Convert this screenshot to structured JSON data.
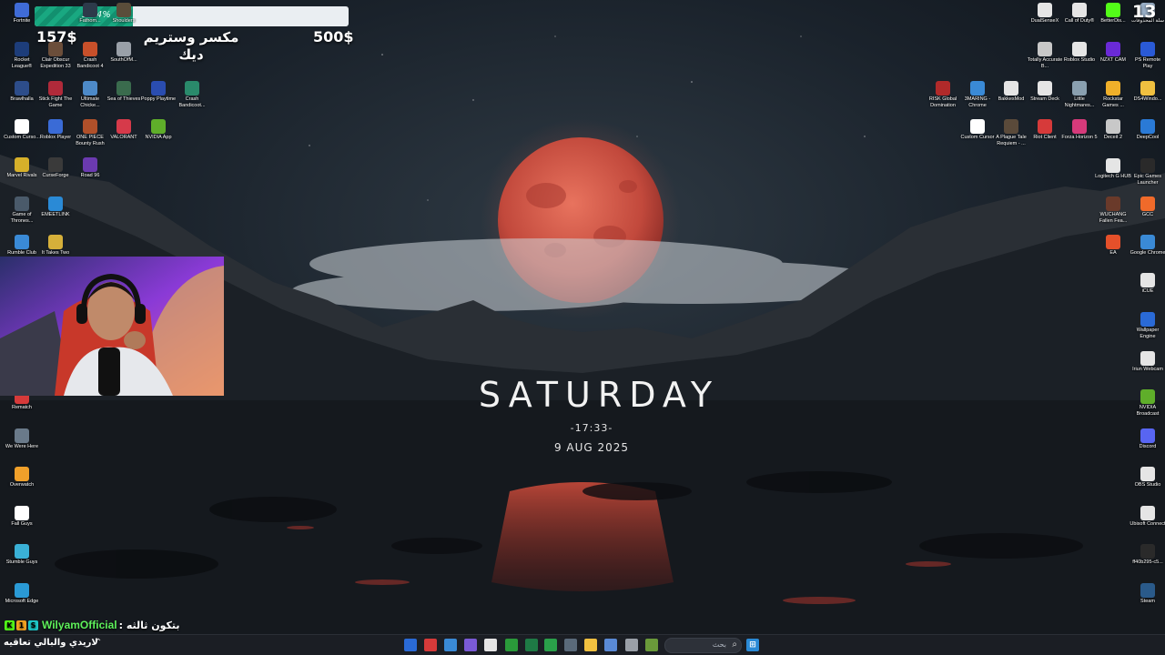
{
  "overlay": {
    "progress_label": "31.4%",
    "progress_fraction": 0.314,
    "current_amount": "157$",
    "target_amount": "500$",
    "goal_line1": "مكسر وستريم",
    "goal_line2": "ديك"
  },
  "clock": {
    "day": "SATURDAY",
    "time": "-17:33-",
    "date": "9 AUG 2025"
  },
  "chat": {
    "username": "WilyamOfficial",
    "message": "بتكون ثالثه :"
  },
  "taskbar": {
    "ticker_text": "لاريدي والبالي تعاقيه",
    "search_placeholder": "بحث"
  },
  "top_right_counter": "13",
  "desktop_left": [
    {
      "label": "Fortnite",
      "icon": "fortnite-icon",
      "color": "#3f6bd6"
    },
    {
      "label": "Fathom...",
      "icon": "game-icon",
      "color": "#2d3a4a"
    },
    {
      "label": "Shoulders",
      "icon": "game-icon",
      "color": "#5a4d3a"
    },
    {
      "label": "Rocket League®",
      "icon": "rocket-league-icon",
      "color": "#1d3d7a"
    },
    {
      "label": "Clair Obscur Expedition 33",
      "icon": "game-icon",
      "color": "#6b4e3a"
    },
    {
      "label": "Crash Bandicoot 4",
      "icon": "game-icon",
      "color": "#c8502a"
    },
    {
      "label": "SouthOfM...",
      "icon": "game-icon",
      "color": "#9aa0a8"
    },
    {
      "label": "Brawlhalla",
      "icon": "game-icon",
      "color": "#2d4d8a"
    },
    {
      "label": "Stick Fight The Game",
      "icon": "game-icon",
      "color": "#b02a3a"
    },
    {
      "label": "Ultimate Chicke...",
      "icon": "game-icon",
      "color": "#4d8ac8"
    },
    {
      "label": "Sea of Thieves",
      "icon": "game-icon",
      "color": "#3a6b4d"
    },
    {
      "label": "Poppy Playtime",
      "icon": "game-icon",
      "color": "#2a4db0"
    },
    {
      "label": "Crash Bandicoot...",
      "icon": "game-icon",
      "color": "#2a8a6b"
    },
    {
      "label": "Custom Curso...",
      "icon": "cursor-icon",
      "color": "#ffffff"
    },
    {
      "label": "Roblox Player",
      "icon": "roblox-icon",
      "color": "#3a6bd6"
    },
    {
      "label": "ONE PIECE Bounty Rush",
      "icon": "game-icon",
      "color": "#b0502a"
    },
    {
      "label": "VALORANT",
      "icon": "valorant-icon",
      "color": "#d63a4a"
    },
    {
      "label": "NVIDIA App",
      "icon": "nvidia-icon",
      "color": "#5fae2a"
    },
    {
      "label": "Marvel Rivals",
      "icon": "game-icon",
      "color": "#d6b02a"
    },
    {
      "label": "CurseForge",
      "icon": "curseforge-icon",
      "color": "#3a3a3a"
    },
    {
      "label": "Road 96",
      "icon": "game-icon",
      "color": "#6b3ab0"
    },
    {
      "label": "Game of Thrones...",
      "icon": "game-icon",
      "color": "#4a5a6a"
    },
    {
      "label": "EMEETLINK",
      "icon": "emeet-icon",
      "color": "#2a8ad6"
    },
    {
      "label": "Rumble Club",
      "icon": "game-icon",
      "color": "#3a8ad6"
    },
    {
      "label": "It Takes Two",
      "icon": "game-icon",
      "color": "#d6b03a"
    },
    {
      "label": "Rematch",
      "icon": "game-icon",
      "color": "#d63a3a"
    },
    {
      "label": "We Were Here",
      "icon": "game-icon",
      "color": "#6a7a8a"
    },
    {
      "label": "Overwatch",
      "icon": "overwatch-icon",
      "color": "#f0a02a"
    },
    {
      "label": "Fall Guys",
      "icon": "fall-guys-icon",
      "color": "#ffffff"
    },
    {
      "label": "Stumble Guys",
      "icon": "game-icon",
      "color": "#3ab0d6"
    },
    {
      "label": "Microsoft Edge",
      "icon": "edge-icon",
      "color": "#2a9ad6"
    }
  ],
  "desktop_right": [
    {
      "label": "DualSenseX",
      "icon": "controller-icon",
      "color": "#e5e5e5"
    },
    {
      "label": "Call of Duty®",
      "icon": "cod-icon",
      "color": "#e5e5e5"
    },
    {
      "label": "BetterDis...",
      "icon": "kick-icon",
      "color": "#53fc18"
    },
    {
      "label": "سلة المحذوفات",
      "icon": "recycle-bin-icon",
      "color": "#9ab0c8"
    },
    {
      "label": "Totally Accurate B...",
      "icon": "game-icon",
      "color": "#c8c8c8"
    },
    {
      "label": "Roblox Studio",
      "icon": "roblox-studio-icon",
      "color": "#e5e5e5"
    },
    {
      "label": "NZXT CAM",
      "icon": "nzxt-icon",
      "color": "#6a2ad6"
    },
    {
      "label": "PS Remote Play",
      "icon": "ps-icon",
      "color": "#2a5ad6"
    },
    {
      "label": "RISK Global Domination",
      "icon": "game-icon",
      "color": "#b02a2a"
    },
    {
      "label": "3MARING - Chrome",
      "icon": "chrome-icon",
      "color": "#3a8ad6"
    },
    {
      "label": "BakkesMod",
      "icon": "bakkes-icon",
      "color": "#e5e5e5"
    },
    {
      "label": "Stream Deck",
      "icon": "stream-deck-icon",
      "color": "#e5e5e5"
    },
    {
      "label": "Little Nightmares...",
      "icon": "game-icon",
      "color": "#8aa0b0"
    },
    {
      "label": "Rockstar Games ...",
      "icon": "rockstar-icon",
      "color": "#f0b02a"
    },
    {
      "label": "DS4Windo...",
      "icon": "folder-icon",
      "color": "#f0c040"
    },
    {
      "label": "Custom Cursor",
      "icon": "cursor-icon",
      "color": "#ffffff"
    },
    {
      "label": "A Plague Tale Requiem - ...",
      "icon": "game-icon",
      "color": "#5a4a3a"
    },
    {
      "label": "Riot Client",
      "icon": "riot-icon",
      "color": "#d63a3a"
    },
    {
      "label": "Forza Horizon 5",
      "icon": "game-icon",
      "color": "#d63a7a"
    },
    {
      "label": "Deceit 2",
      "icon": "game-icon",
      "color": "#c8c8c8"
    },
    {
      "label": "DeepCool",
      "icon": "deepcool-icon",
      "color": "#2a7ad6"
    },
    {
      "label": "Logitech G HUB",
      "icon": "logitech-icon",
      "color": "#e5e5e5"
    },
    {
      "label": "Epic Games Launcher",
      "icon": "epic-icon",
      "color": "#2a2a2a"
    },
    {
      "label": "WUCHANG Fallen Fea...",
      "icon": "game-icon",
      "color": "#6a3a2a"
    },
    {
      "label": "GCC",
      "icon": "gcc-icon",
      "color": "#f06a2a"
    },
    {
      "label": "EA",
      "icon": "ea-icon",
      "color": "#e5502a"
    },
    {
      "label": "Google Chrome",
      "icon": "chrome-icon",
      "color": "#3a8ad6"
    },
    {
      "label": "iCUE",
      "icon": "icue-icon",
      "color": "#e5e5e5"
    },
    {
      "label": "Wallpaper Engine",
      "icon": "wallpaper-engine-icon",
      "color": "#2a6ad6"
    },
    {
      "label": "Iriun Webcam",
      "icon": "webcam-icon",
      "color": "#e5e5e5"
    },
    {
      "label": "NVIDIA Broadcast",
      "icon": "nvidia-icon",
      "color": "#5fae2a"
    },
    {
      "label": "Discord",
      "icon": "discord-icon",
      "color": "#5865f2"
    },
    {
      "label": "OBS Studio",
      "icon": "obs-icon",
      "color": "#e5e5e5"
    },
    {
      "label": "Ubisoft Connect",
      "icon": "ubisoft-icon",
      "color": "#e5e5e5"
    },
    {
      "label": "ff40b295-c5...",
      "icon": "file-icon",
      "color": "#2a2a2a"
    },
    {
      "label": "Steam",
      "icon": "steam-icon",
      "color": "#2a5a8a"
    }
  ],
  "taskbar_apps": [
    {
      "icon": "widgets-icon",
      "color": "#2a6ad6"
    },
    {
      "icon": "riot-icon",
      "color": "#d63a3a"
    },
    {
      "icon": "chrome-icon",
      "color": "#3a8ad6"
    },
    {
      "icon": "browser-icon",
      "color": "#7a5ad6"
    },
    {
      "icon": "capcut-icon",
      "color": "#e5e5e5"
    },
    {
      "icon": "xbox-icon",
      "color": "#2a9a3a"
    },
    {
      "icon": "excel-icon",
      "color": "#1e7a45"
    },
    {
      "icon": "play-icon",
      "color": "#2aa04a"
    },
    {
      "icon": "calculator-icon",
      "color": "#5a6a7a"
    },
    {
      "icon": "explorer-icon",
      "color": "#f0c040"
    },
    {
      "icon": "copilot-icon",
      "color": "#5a8ad6"
    },
    {
      "icon": "window-icon",
      "color": "#9aa0a8"
    },
    {
      "icon": "news-icon",
      "color": "#6a9a3a"
    }
  ]
}
